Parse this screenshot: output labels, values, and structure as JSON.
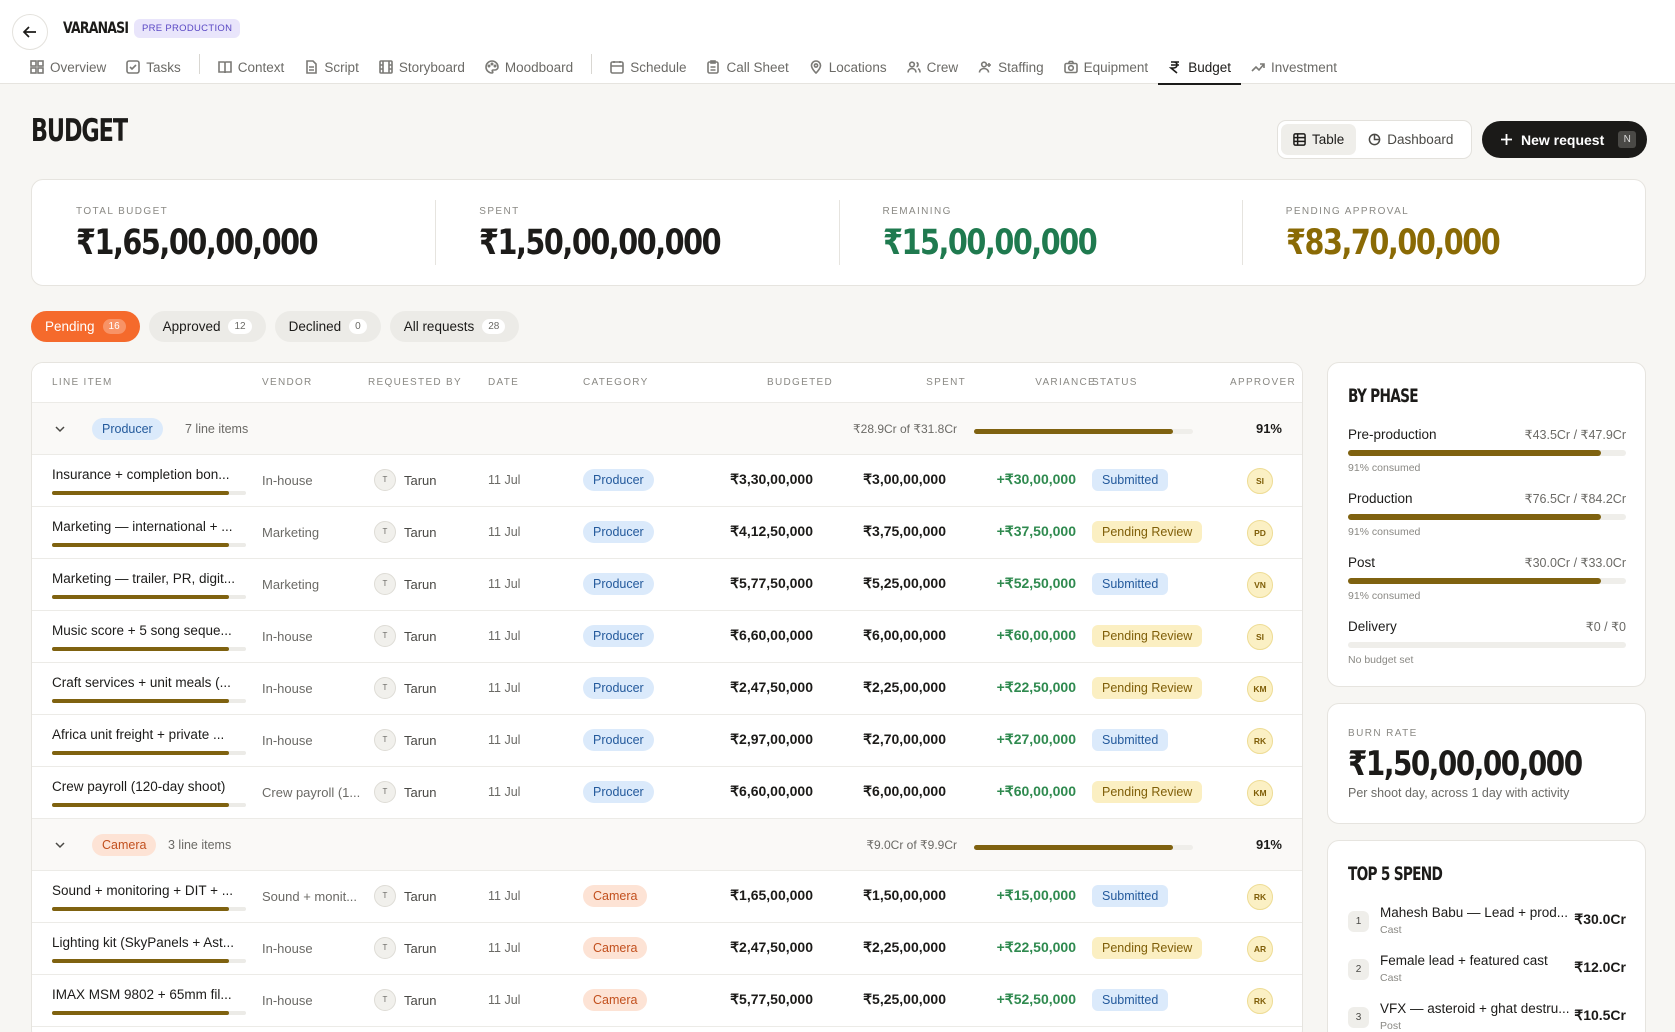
{
  "header": {
    "project": "VARANASI",
    "stage": "PRE PRODUCTION"
  },
  "tabs": [
    {
      "label": "Overview",
      "icon": "grid-icon"
    },
    {
      "label": "Tasks",
      "icon": "checkbox-icon"
    },
    {
      "label": "Context",
      "icon": "book-icon"
    },
    {
      "label": "Script",
      "icon": "document-icon"
    },
    {
      "label": "Storyboard",
      "icon": "film-icon"
    },
    {
      "label": "Moodboard",
      "icon": "palette-icon"
    },
    {
      "label": "Schedule",
      "icon": "calendar-icon"
    },
    {
      "label": "Call Sheet",
      "icon": "clipboard-icon"
    },
    {
      "label": "Locations",
      "icon": "pin-icon"
    },
    {
      "label": "Crew",
      "icon": "users-icon"
    },
    {
      "label": "Staffing",
      "icon": "user-plus-icon"
    },
    {
      "label": "Equipment",
      "icon": "camera-icon"
    },
    {
      "label": "Budget",
      "icon": "rupee-icon"
    },
    {
      "label": "Investment",
      "icon": "trending-up-icon"
    }
  ],
  "page": {
    "title": "BUDGET"
  },
  "view": {
    "table": "Table",
    "dashboard": "Dashboard"
  },
  "new_request": {
    "label": "New request",
    "shortcut": "N"
  },
  "stats": [
    {
      "label": "TOTAL BUDGET",
      "value": "₹1,65,00,00,000",
      "color": "#1c1b19"
    },
    {
      "label": "SPENT",
      "value": "₹1,50,00,00,000",
      "color": "#1c1b19"
    },
    {
      "label": "REMAINING",
      "value": "₹15,00,00,000",
      "color": "#1f7a4f"
    },
    {
      "label": "PENDING APPROVAL",
      "value": "₹83,70,00,000",
      "color": "#8a6a05"
    }
  ],
  "filters": [
    {
      "label": "Pending",
      "count": "16"
    },
    {
      "label": "Approved",
      "count": "12"
    },
    {
      "label": "Declined",
      "count": "0"
    },
    {
      "label": "All requests",
      "count": "28"
    }
  ],
  "columns": [
    "LINE ITEM",
    "VENDOR",
    "REQUESTED BY",
    "DATE",
    "CATEGORY",
    "BUDGETED",
    "SPENT",
    "VARIANCE",
    "STATUS",
    "APPROVER"
  ],
  "groups": [
    {
      "name": "Producer",
      "count_label": "7 line items",
      "summary": "₹28.9Cr of ₹31.8Cr",
      "progress": 0.91,
      "pct": "91%",
      "rows": [
        {
          "item": "Insurance + completion bon...",
          "vendor": "In-house",
          "avatar": "T",
          "requested_by": "Tarun",
          "date": "11 Jul",
          "category": "Producer",
          "budgeted": "₹3,30,00,000",
          "spent": "₹3,00,00,000",
          "variance": "+₹30,00,000",
          "status": "Submitted",
          "approver": "SI"
        },
        {
          "item": "Marketing — international + ...",
          "vendor": "Marketing",
          "avatar": "T",
          "requested_by": "Tarun",
          "date": "11 Jul",
          "category": "Producer",
          "budgeted": "₹4,12,50,000",
          "spent": "₹3,75,00,000",
          "variance": "+₹37,50,000",
          "status": "Pending Review",
          "approver": "PD"
        },
        {
          "item": "Marketing — trailer, PR, digit...",
          "vendor": "Marketing",
          "avatar": "T",
          "requested_by": "Tarun",
          "date": "11 Jul",
          "category": "Producer",
          "budgeted": "₹5,77,50,000",
          "spent": "₹5,25,00,000",
          "variance": "+₹52,50,000",
          "status": "Submitted",
          "approver": "VN"
        },
        {
          "item": "Music score + 5 song seque...",
          "vendor": "In-house",
          "avatar": "T",
          "requested_by": "Tarun",
          "date": "11 Jul",
          "category": "Producer",
          "budgeted": "₹6,60,00,000",
          "spent": "₹6,00,00,000",
          "variance": "+₹60,00,000",
          "status": "Pending Review",
          "approver": "SI"
        },
        {
          "item": "Craft services + unit meals (...",
          "vendor": "In-house",
          "avatar": "T",
          "requested_by": "Tarun",
          "date": "11 Jul",
          "category": "Producer",
          "budgeted": "₹2,47,50,000",
          "spent": "₹2,25,00,000",
          "variance": "+₹22,50,000",
          "status": "Pending Review",
          "approver": "KM"
        },
        {
          "item": "Africa unit freight + private ...",
          "vendor": "In-house",
          "avatar": "T",
          "requested_by": "Tarun",
          "date": "11 Jul",
          "category": "Producer",
          "budgeted": "₹2,97,00,000",
          "spent": "₹2,70,00,000",
          "variance": "+₹27,00,000",
          "status": "Submitted",
          "approver": "RK"
        },
        {
          "item": "Crew payroll (120-day shoot)",
          "vendor": "Crew payroll (1...",
          "avatar": "T",
          "requested_by": "Tarun",
          "date": "11 Jul",
          "category": "Producer",
          "budgeted": "₹6,60,00,000",
          "spent": "₹6,00,00,000",
          "variance": "+₹60,00,000",
          "status": "Pending Review",
          "approver": "KM"
        }
      ]
    },
    {
      "name": "Camera",
      "count_label": "3 line items",
      "summary": "₹9.0Cr of ₹9.9Cr",
      "progress": 0.91,
      "pct": "91%",
      "rows": [
        {
          "item": "Sound + monitoring + DIT + ...",
          "vendor": "Sound + monit...",
          "avatar": "T",
          "requested_by": "Tarun",
          "date": "11 Jul",
          "category": "Camera",
          "budgeted": "₹1,65,00,000",
          "spent": "₹1,50,00,000",
          "variance": "+₹15,00,000",
          "status": "Submitted",
          "approver": "RK"
        },
        {
          "item": "Lighting kit (SkyPanels + Ast...",
          "vendor": "In-house",
          "avatar": "T",
          "requested_by": "Tarun",
          "date": "11 Jul",
          "category": "Camera",
          "budgeted": "₹2,47,50,000",
          "spent": "₹2,25,00,000",
          "variance": "+₹22,50,000",
          "status": "Pending Review",
          "approver": "AR"
        },
        {
          "item": "IMAX MSM 9802 + 65mm fil...",
          "vendor": "In-house",
          "avatar": "T",
          "requested_by": "Tarun",
          "date": "11 Jul",
          "category": "Camera",
          "budgeted": "₹5,77,50,000",
          "spent": "₹5,25,00,000",
          "variance": "+₹52,50,000",
          "status": "Submitted",
          "approver": "RK"
        }
      ]
    }
  ],
  "by_phase": {
    "title": "BY PHASE",
    "phases": [
      {
        "name": "Pre-production",
        "amount": "₹43.5Cr / ₹47.9Cr",
        "progress": 0.91,
        "note": "91% consumed"
      },
      {
        "name": "Production",
        "amount": "₹76.5Cr / ₹84.2Cr",
        "progress": 0.91,
        "note": "91% consumed"
      },
      {
        "name": "Post",
        "amount": "₹30.0Cr / ₹33.0Cr",
        "progress": 0.91,
        "note": "91% consumed"
      },
      {
        "name": "Delivery",
        "amount": "₹0 / ₹0",
        "progress": 0,
        "note": "No budget set"
      }
    ]
  },
  "burn_rate": {
    "label": "BURN RATE",
    "value": "₹1,50,00,00,000",
    "sub": "Per shoot day, across 1 day with activity"
  },
  "top_spend": {
    "title": "TOP 5 SPEND",
    "items": [
      {
        "rank": "1",
        "name": "Mahesh Babu — Lead + prod...",
        "category": "Cast",
        "amount": "₹30.0Cr"
      },
      {
        "rank": "2",
        "name": "Female lead + featured cast",
        "category": "Cast",
        "amount": "₹12.0Cr"
      },
      {
        "rank": "3",
        "name": "VFX — asteroid + ghat destru...",
        "category": "Post",
        "amount": "₹10.5Cr"
      }
    ]
  }
}
